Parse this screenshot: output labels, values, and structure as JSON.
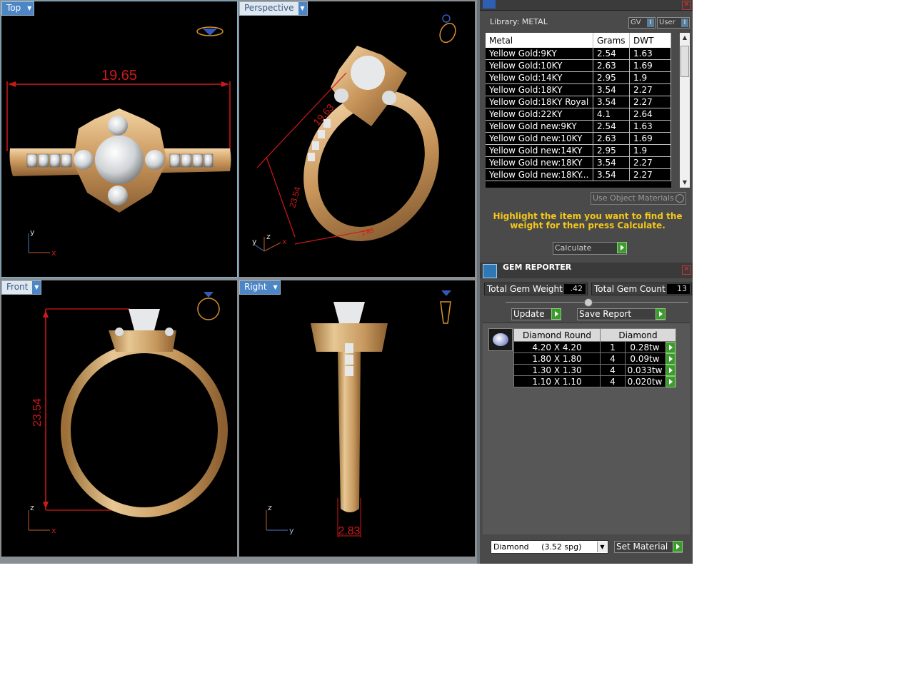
{
  "viewports": {
    "top": {
      "label": "Top",
      "dimension": "19.65"
    },
    "perspective": {
      "label": "Perspective",
      "dimension_a": "19.63",
      "dimension_b": "23.54",
      "dimension_c": "2.83"
    },
    "front": {
      "label": "Front",
      "dimension": "23.54"
    },
    "right": {
      "label": "Right",
      "dimension": "2.83"
    }
  },
  "axes": {
    "x": "x",
    "y": "y",
    "z": "z"
  },
  "metal_library": {
    "label": "Library: METAL",
    "gv_button": "GV",
    "user_button": "User",
    "columns": [
      "Metal",
      "Grams",
      "DWT"
    ],
    "rows": [
      [
        "Yellow Gold:9KY",
        "2.54",
        "1.63"
      ],
      [
        "Yellow Gold:10KY",
        "2.63",
        "1.69"
      ],
      [
        "Yellow Gold:14KY",
        "2.95",
        "1.9"
      ],
      [
        "Yellow Gold:18KY",
        "3.54",
        "2.27"
      ],
      [
        "Yellow Gold:18KY Royal",
        "3.54",
        "2.27"
      ],
      [
        "Yellow Gold:22KY",
        "4.1",
        "2.64"
      ],
      [
        "Yellow Gold new:9KY",
        "2.54",
        "1.63"
      ],
      [
        "Yellow Gold new:10KY",
        "2.63",
        "1.69"
      ],
      [
        "Yellow Gold new:14KY",
        "2.95",
        "1.9"
      ],
      [
        "Yellow Gold new:18KY",
        "3.54",
        "2.27"
      ],
      [
        "Yellow Gold new:18KY...",
        "3.54",
        "2.27"
      ]
    ],
    "use_object_materials": "Use Object Materials",
    "hint": "Highlight the item you want to find the weight for then press Calculate.",
    "calculate_button": "Calculate"
  },
  "gem_reporter": {
    "title": "GEM REPORTER",
    "total_weight_label": "Total Gem Weight",
    "total_weight_value": ".42",
    "total_count_label": "Total Gem Count",
    "total_count_value": "13",
    "update_button": "Update",
    "save_report_button": "Save Report",
    "table_header_shape": "Diamond Round",
    "table_header_material": "Diamond",
    "rows": [
      [
        "4.20 X 4.20",
        "1",
        "0.28tw"
      ],
      [
        "1.80 X 1.80",
        "4",
        "0.09tw"
      ],
      [
        "1.30 X 1.30",
        "4",
        "0.033tw"
      ],
      [
        "1.10 X 1.10",
        "4",
        "0.020tw"
      ]
    ],
    "material_select": "Diamond     (3.52 spg)",
    "set_material_button": "Set Material"
  },
  "colors": {
    "viewport_bg": "#000000",
    "dimension_red": "#d11818",
    "gold": "#c79a62",
    "hint_yellow": "#f4c718",
    "green_button": "#3c9a2e"
  }
}
